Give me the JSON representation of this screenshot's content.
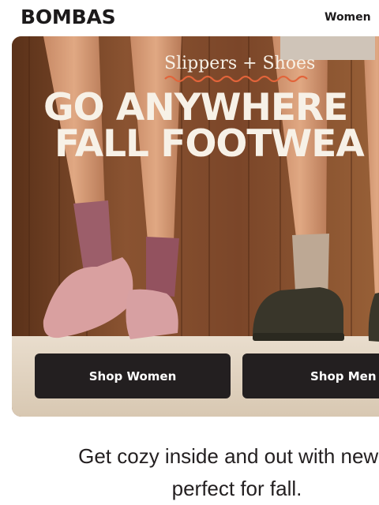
{
  "header": {
    "logo": "BOMBAS",
    "nav_women": "Women"
  },
  "hero": {
    "eyebrow": "Slippers + Shoes",
    "headline_line1": "GO ANYWHERE",
    "headline_line2": "FALL FOOTWEA",
    "buttons": {
      "shop_women": "Shop Women",
      "shop_men": "Shop Men"
    }
  },
  "tagline": {
    "line1": "Get cozy inside and out with new p",
    "line2": "perfect for fall."
  },
  "colors": {
    "brand_dark": "#231f20",
    "headline_cream": "#f7f1e7",
    "squiggle_orange": "#e2643a"
  }
}
